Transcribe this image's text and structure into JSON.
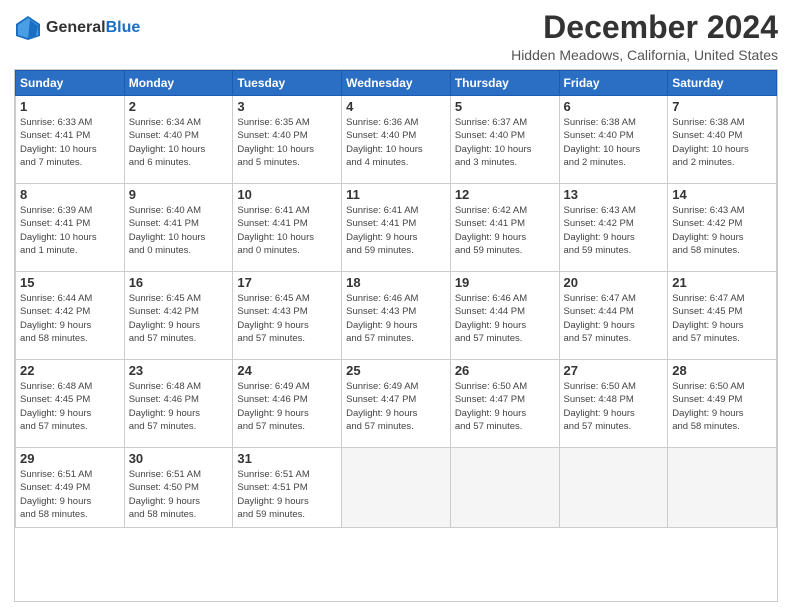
{
  "header": {
    "logo_line1": "General",
    "logo_line2": "Blue",
    "title": "December 2024",
    "subtitle": "Hidden Meadows, California, United States"
  },
  "calendar": {
    "days_of_week": [
      "Sunday",
      "Monday",
      "Tuesday",
      "Wednesday",
      "Thursday",
      "Friday",
      "Saturday"
    ],
    "weeks": [
      [
        {
          "day": "1",
          "info": "Sunrise: 6:33 AM\nSunset: 4:41 PM\nDaylight: 10 hours\nand 7 minutes."
        },
        {
          "day": "2",
          "info": "Sunrise: 6:34 AM\nSunset: 4:40 PM\nDaylight: 10 hours\nand 6 minutes."
        },
        {
          "day": "3",
          "info": "Sunrise: 6:35 AM\nSunset: 4:40 PM\nDaylight: 10 hours\nand 5 minutes."
        },
        {
          "day": "4",
          "info": "Sunrise: 6:36 AM\nSunset: 4:40 PM\nDaylight: 10 hours\nand 4 minutes."
        },
        {
          "day": "5",
          "info": "Sunrise: 6:37 AM\nSunset: 4:40 PM\nDaylight: 10 hours\nand 3 minutes."
        },
        {
          "day": "6",
          "info": "Sunrise: 6:38 AM\nSunset: 4:40 PM\nDaylight: 10 hours\nand 2 minutes."
        },
        {
          "day": "7",
          "info": "Sunrise: 6:38 AM\nSunset: 4:40 PM\nDaylight: 10 hours\nand 2 minutes."
        }
      ],
      [
        {
          "day": "8",
          "info": "Sunrise: 6:39 AM\nSunset: 4:41 PM\nDaylight: 10 hours\nand 1 minute."
        },
        {
          "day": "9",
          "info": "Sunrise: 6:40 AM\nSunset: 4:41 PM\nDaylight: 10 hours\nand 0 minutes."
        },
        {
          "day": "10",
          "info": "Sunrise: 6:41 AM\nSunset: 4:41 PM\nDaylight: 10 hours\nand 0 minutes."
        },
        {
          "day": "11",
          "info": "Sunrise: 6:41 AM\nSunset: 4:41 PM\nDaylight: 9 hours\nand 59 minutes."
        },
        {
          "day": "12",
          "info": "Sunrise: 6:42 AM\nSunset: 4:41 PM\nDaylight: 9 hours\nand 59 minutes."
        },
        {
          "day": "13",
          "info": "Sunrise: 6:43 AM\nSunset: 4:42 PM\nDaylight: 9 hours\nand 59 minutes."
        },
        {
          "day": "14",
          "info": "Sunrise: 6:43 AM\nSunset: 4:42 PM\nDaylight: 9 hours\nand 58 minutes."
        }
      ],
      [
        {
          "day": "15",
          "info": "Sunrise: 6:44 AM\nSunset: 4:42 PM\nDaylight: 9 hours\nand 58 minutes."
        },
        {
          "day": "16",
          "info": "Sunrise: 6:45 AM\nSunset: 4:42 PM\nDaylight: 9 hours\nand 57 minutes."
        },
        {
          "day": "17",
          "info": "Sunrise: 6:45 AM\nSunset: 4:43 PM\nDaylight: 9 hours\nand 57 minutes."
        },
        {
          "day": "18",
          "info": "Sunrise: 6:46 AM\nSunset: 4:43 PM\nDaylight: 9 hours\nand 57 minutes."
        },
        {
          "day": "19",
          "info": "Sunrise: 6:46 AM\nSunset: 4:44 PM\nDaylight: 9 hours\nand 57 minutes."
        },
        {
          "day": "20",
          "info": "Sunrise: 6:47 AM\nSunset: 4:44 PM\nDaylight: 9 hours\nand 57 minutes."
        },
        {
          "day": "21",
          "info": "Sunrise: 6:47 AM\nSunset: 4:45 PM\nDaylight: 9 hours\nand 57 minutes."
        }
      ],
      [
        {
          "day": "22",
          "info": "Sunrise: 6:48 AM\nSunset: 4:45 PM\nDaylight: 9 hours\nand 57 minutes."
        },
        {
          "day": "23",
          "info": "Sunrise: 6:48 AM\nSunset: 4:46 PM\nDaylight: 9 hours\nand 57 minutes."
        },
        {
          "day": "24",
          "info": "Sunrise: 6:49 AM\nSunset: 4:46 PM\nDaylight: 9 hours\nand 57 minutes."
        },
        {
          "day": "25",
          "info": "Sunrise: 6:49 AM\nSunset: 4:47 PM\nDaylight: 9 hours\nand 57 minutes."
        },
        {
          "day": "26",
          "info": "Sunrise: 6:50 AM\nSunset: 4:47 PM\nDaylight: 9 hours\nand 57 minutes."
        },
        {
          "day": "27",
          "info": "Sunrise: 6:50 AM\nSunset: 4:48 PM\nDaylight: 9 hours\nand 57 minutes."
        },
        {
          "day": "28",
          "info": "Sunrise: 6:50 AM\nSunset: 4:49 PM\nDaylight: 9 hours\nand 58 minutes."
        }
      ],
      [
        {
          "day": "29",
          "info": "Sunrise: 6:51 AM\nSunset: 4:49 PM\nDaylight: 9 hours\nand 58 minutes."
        },
        {
          "day": "30",
          "info": "Sunrise: 6:51 AM\nSunset: 4:50 PM\nDaylight: 9 hours\nand 58 minutes."
        },
        {
          "day": "31",
          "info": "Sunrise: 6:51 AM\nSunset: 4:51 PM\nDaylight: 9 hours\nand 59 minutes."
        },
        {
          "day": "",
          "info": ""
        },
        {
          "day": "",
          "info": ""
        },
        {
          "day": "",
          "info": ""
        },
        {
          "day": "",
          "info": ""
        }
      ]
    ]
  }
}
